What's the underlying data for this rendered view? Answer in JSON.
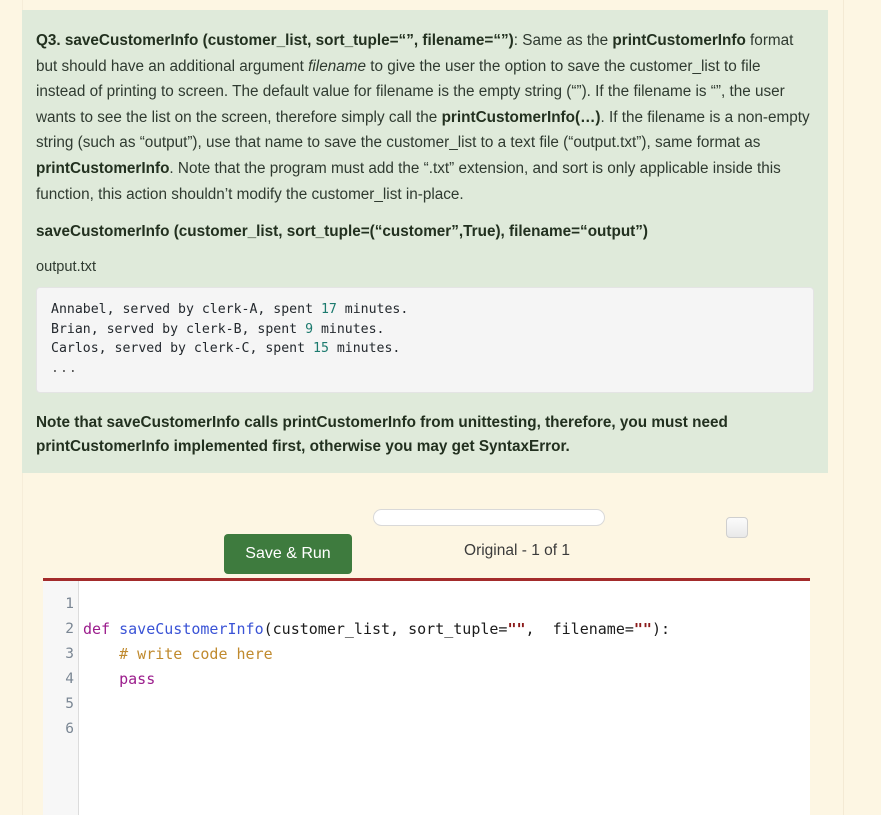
{
  "question": {
    "paragraph_segments": [
      {
        "text": "Q3. saveCustomerInfo (customer_list, sort_tuple=“”, filename=“”)",
        "style": "bold"
      },
      {
        "text": ": Same as the ",
        "style": "normal"
      },
      {
        "text": "printCustomerInfo",
        "style": "bold"
      },
      {
        "text": " format but should have an additional argument ",
        "style": "normal"
      },
      {
        "text": "filename",
        "style": "italic"
      },
      {
        "text": " to give the user the option to save the customer_list to file instead of printing to screen. The default value for filename is the empty string (“”). If the filename is “”, the user wants to see the list on the screen, therefore simply call the ",
        "style": "normal"
      },
      {
        "text": "printCustomerInfo(…)",
        "style": "bold"
      },
      {
        "text": ". If the filename is a non-empty string (such as “output”), use that name to save the customer_list to a text file (“output.txt”), same format as ",
        "style": "normal"
      },
      {
        "text": "printCustomerInfo",
        "style": "bold"
      },
      {
        "text": ". Note that the program must add the “.txt” extension, and sort is only applicable inside this function, this action shouldn’t modify the customer_list in-place.",
        "style": "normal"
      }
    ],
    "signature": "saveCustomerInfo (customer_list, sort_tuple=(“customer”,True), filename=“output”)",
    "file_label": "output.txt",
    "output_lines": [
      {
        "prefix": "Annabel, served by clerk-A, spent ",
        "number": "17",
        "suffix": " minutes."
      },
      {
        "prefix": "Brian, served by clerk-B, spent ",
        "number": "9",
        "suffix": " minutes."
      },
      {
        "prefix": "Carlos, served by clerk-C, spent ",
        "number": "15",
        "suffix": " minutes."
      }
    ],
    "output_ellipsis": "...",
    "note": "Note that saveCustomerInfo calls printCustomerInfo from unittesting, therefore, you must need printCustomerInfo implemented first, otherwise you may get SyntaxError."
  },
  "toolbar": {
    "save_run_label": "Save & Run",
    "version_label": "Original - 1 of 1",
    "slider_value": 0
  },
  "editor": {
    "line_numbers": [
      "1",
      "2",
      "3",
      "4",
      "5",
      "6"
    ],
    "lines": [
      {
        "tokens": []
      },
      {
        "tokens": [
          {
            "t": "def ",
            "k": "kw"
          },
          {
            "t": "saveCustomerInfo",
            "k": "fn"
          },
          {
            "t": "(customer_list, sort_tuple=",
            "k": "plain"
          },
          {
            "t": "\"\"",
            "k": "str"
          },
          {
            "t": ",  filename=",
            "k": "plain"
          },
          {
            "t": "\"\"",
            "k": "str"
          },
          {
            "t": "):",
            "k": "plain"
          }
        ]
      },
      {
        "tokens": [
          {
            "t": "    # write code here",
            "k": "com"
          }
        ]
      },
      {
        "tokens": [
          {
            "t": "    ",
            "k": "plain"
          },
          {
            "t": "pass",
            "k": "kw"
          }
        ]
      },
      {
        "tokens": []
      },
      {
        "tokens": []
      }
    ]
  },
  "colors": {
    "page_background": "#fdf6e3",
    "panel_background": "#dfeada",
    "button_green": "#3e7b3e",
    "editor_top_border": "#a32b2b",
    "output_number": "#1c7a6e"
  }
}
